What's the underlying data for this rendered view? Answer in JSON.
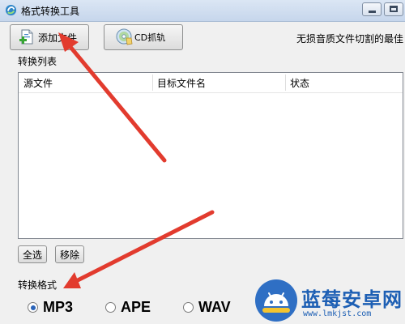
{
  "window": {
    "title": "格式转换工具"
  },
  "toolbar": {
    "add_file_label": "添加文件",
    "cd_rip_label": "CD抓轨",
    "tagline": "无损音质文件切割的最佳"
  },
  "file_list": {
    "label": "转换列表",
    "columns": [
      "源文件",
      "目标文件名",
      "状态"
    ],
    "rows": []
  },
  "list_actions": {
    "select_all_label": "全选",
    "remove_label": "移除"
  },
  "format": {
    "label": "转换格式",
    "options": [
      "MP3",
      "APE",
      "WAV"
    ],
    "selected": "MP3"
  },
  "watermark": {
    "title": "蓝莓安卓网",
    "url": "www.lmkjst.com"
  },
  "colors": {
    "annotation_arrow": "#e23b2e",
    "watermark_blue": "#1d5fb4",
    "titlebar": "#c6d6ec"
  }
}
